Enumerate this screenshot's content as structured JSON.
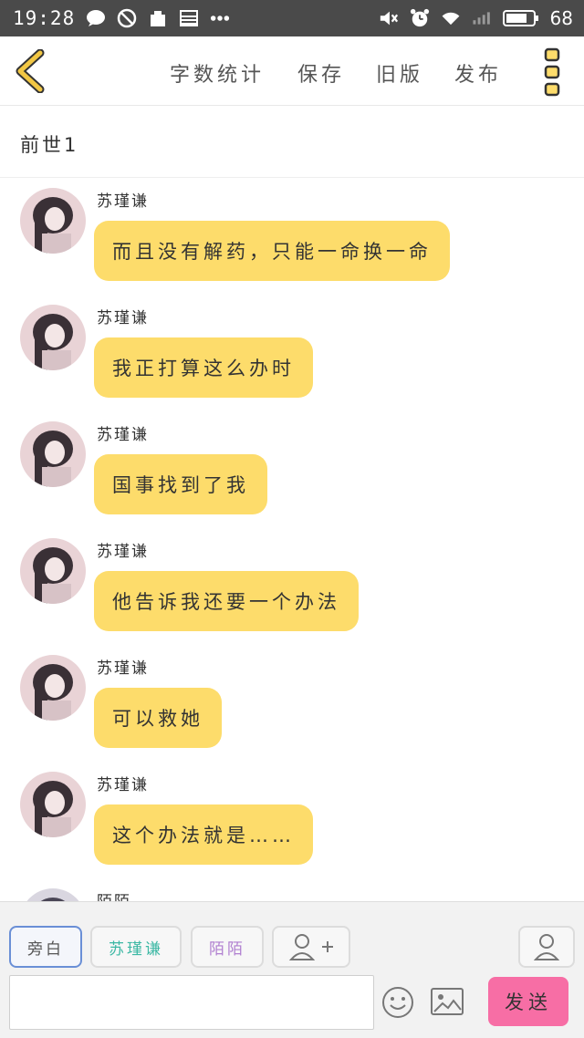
{
  "status_bar": {
    "time": "19:28",
    "battery": "68",
    "icons": [
      "chat-bubble-icon",
      "blocked-icon",
      "app-icon",
      "news-icon",
      "more-dots-icon",
      "mute-icon",
      "alarm-icon",
      "wifi-icon",
      "signal-icon",
      "battery-icon"
    ]
  },
  "header": {
    "back_icon": "chevron-left-icon",
    "actions": [
      "字数统计",
      "保存",
      "旧版",
      "发布"
    ],
    "more_icon": "vertical-menu-icon",
    "accent_color": "#f2c744"
  },
  "title": "前世1",
  "messages": [
    {
      "sender": "苏瑾谦",
      "text": "而且没有解药，只能一命换一命"
    },
    {
      "sender": "苏瑾谦",
      "text": "我正打算这么办时"
    },
    {
      "sender": "苏瑾谦",
      "text": "国事找到了我"
    },
    {
      "sender": "苏瑾谦",
      "text": "他告诉我还要一个办法"
    },
    {
      "sender": "苏瑾谦",
      "text": "可以救她"
    },
    {
      "sender": "苏瑾谦",
      "text": "这个办法就是……"
    },
    {
      "sender": "陌陌",
      "text": ""
    }
  ],
  "composer": {
    "roles": [
      {
        "label": "旁白",
        "color": "#555555"
      },
      {
        "label": "苏瑾谦",
        "color": "#3cb8a4"
      },
      {
        "label": "陌陌",
        "color": "#b07fd0"
      }
    ],
    "add_role_icon": "add-person-icon",
    "person_icon": "person-icon",
    "input_value": "",
    "emoji_icon": "emoji-icon",
    "image_icon": "image-icon",
    "send_label": "发送",
    "send_color": "#f76ea5",
    "bubble_color": "#fddc6b"
  }
}
